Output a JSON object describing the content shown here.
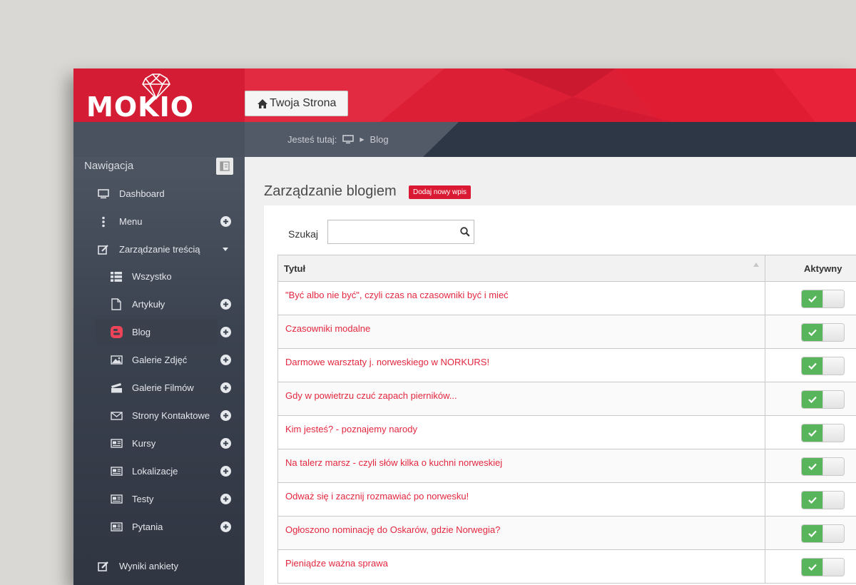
{
  "brand": {
    "logo_text": "MOKIO",
    "site_button_label": "Twoja Strona"
  },
  "breadcrumb": {
    "prefix": "Jesteś tutaj:",
    "current": "Blog"
  },
  "sidebar": {
    "title": "Nawigacja",
    "items": [
      {
        "label": "Dashboard",
        "icon": "monitor-icon",
        "plus": false
      },
      {
        "label": "Menu",
        "icon": "vertical-dots-icon",
        "plus": true
      },
      {
        "label": "Zarządzanie treścią",
        "icon": "edit-square-icon",
        "caret": true
      },
      {
        "label": "Wszystko",
        "icon": "list-icon",
        "plus": false
      },
      {
        "label": "Artykuły",
        "icon": "document-icon",
        "plus": true
      },
      {
        "label": "Blog",
        "icon": "blogger-icon",
        "plus": true,
        "active": true
      },
      {
        "label": "Galerie Zdjęć",
        "icon": "picture-icon",
        "plus": true
      },
      {
        "label": "Galerie Filmów",
        "icon": "clapperboard-icon",
        "plus": true
      },
      {
        "label": "Strony Kontaktowe",
        "icon": "envelope-icon",
        "plus": true
      },
      {
        "label": "Kursy",
        "icon": "newspaper-icon",
        "plus": true
      },
      {
        "label": "Lokalizacje",
        "icon": "newspaper-icon",
        "plus": true
      },
      {
        "label": "Testy",
        "icon": "newspaper-icon",
        "plus": true
      },
      {
        "label": "Pytania",
        "icon": "newspaper-icon",
        "plus": true
      },
      {
        "label": "Wyniki ankiety",
        "icon": "edit-pencil-icon",
        "plus": false
      }
    ]
  },
  "main": {
    "title": "Zarządzanie blogiem",
    "add_button": "Dodaj nowy wpis",
    "search_label": "Szukaj",
    "search_value": "",
    "columns": [
      "Tytuł",
      "Aktywny"
    ],
    "rows": [
      {
        "title": "\"Być albo nie być\", czyli czas na czasowniki być i mieć",
        "active": true
      },
      {
        "title": "Czasowniki modalne",
        "active": true
      },
      {
        "title": "Darmowe warsztaty j. norweskiego w NORKURS!",
        "active": true
      },
      {
        "title": "Gdy w powietrzu czuć zapach pierników...",
        "active": true
      },
      {
        "title": "Kim jesteś? - poznajemy narody",
        "active": true
      },
      {
        "title": "Na talerz marsz - czyli słów kilka o kuchni norweskiej",
        "active": true
      },
      {
        "title": "Odważ się i zacznij rozmawiać po norwesku!",
        "active": true
      },
      {
        "title": "Ogłoszono nominację do Oskarów, gdzie Norwegia?",
        "active": true
      },
      {
        "title": "Pieniądze ważna sprawa",
        "active": true
      }
    ]
  },
  "colors": {
    "accent": "#dc1f35",
    "sidebar": "#3c4350",
    "link": "#e3273f",
    "toggle_on": "#58b55b"
  }
}
